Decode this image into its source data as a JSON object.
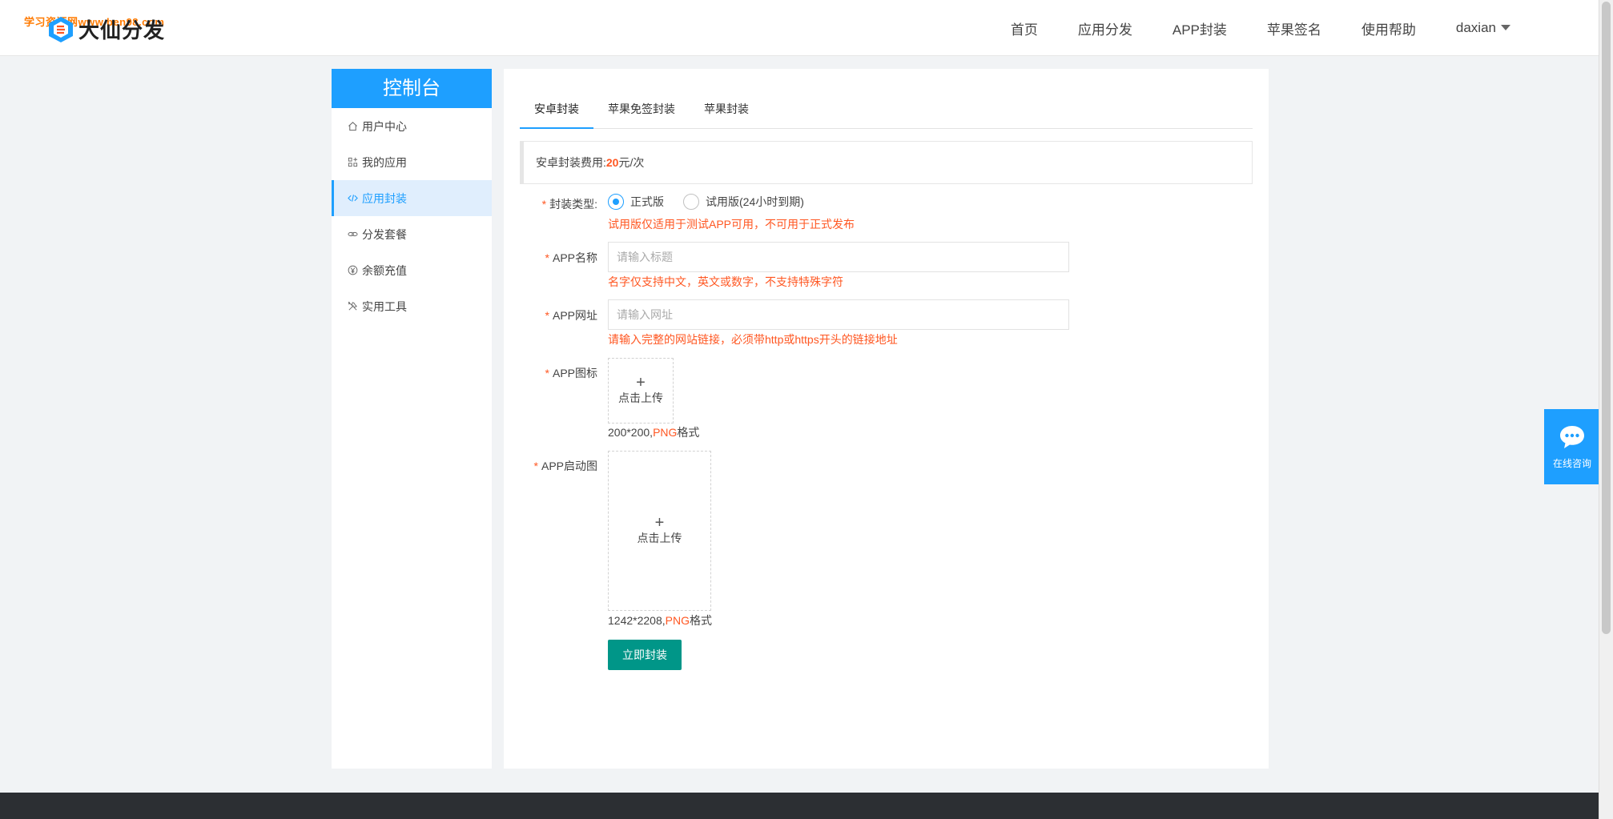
{
  "header": {
    "watermark": "学习资源网www.ben98.com",
    "logo_text": "大仙分发",
    "nav": [
      {
        "label": "首页"
      },
      {
        "label": "应用分发"
      },
      {
        "label": "APP封装"
      },
      {
        "label": "苹果签名"
      },
      {
        "label": "使用帮助"
      }
    ],
    "user": "daxian"
  },
  "sidebar": {
    "title": "控制台",
    "items": [
      {
        "label": "用户中心",
        "icon": "home-icon"
      },
      {
        "label": "我的应用",
        "icon": "apps-icon"
      },
      {
        "label": "应用封装",
        "icon": "code-icon",
        "active": true
      },
      {
        "label": "分发套餐",
        "icon": "link-icon"
      },
      {
        "label": "余额充值",
        "icon": "yen-icon"
      },
      {
        "label": "实用工具",
        "icon": "tools-icon"
      }
    ]
  },
  "tabs": [
    {
      "label": "安卓封装",
      "active": true
    },
    {
      "label": "苹果免签封装"
    },
    {
      "label": "苹果封装"
    }
  ],
  "notice": {
    "prefix": "安卓封装费用:",
    "amount": "20",
    "suffix": "元/次"
  },
  "form": {
    "type": {
      "label": "封装类型:",
      "options": [
        {
          "label": "正式版",
          "checked": true
        },
        {
          "label": "试用版(24小时到期)",
          "checked": false
        }
      ],
      "hint": "试用版仅适用于测试APP可用，不可用于正式发布"
    },
    "name": {
      "label": "APP名称",
      "placeholder": "请输入标题",
      "value": "",
      "hint": "名字仅支持中文，英文或数字，不支持特殊字符"
    },
    "url": {
      "label": "APP网址",
      "placeholder": "请输入网址",
      "value": "",
      "hint": "请输入完整的网站链接，必须带http或https开头的链接地址"
    },
    "icon": {
      "label": "APP图标",
      "upload_label": "点击上传",
      "format_size": "200*200,",
      "format_type": "PNG",
      "format_suffix": "格式"
    },
    "splash": {
      "label": "APP启动图",
      "upload_label": "点击上传",
      "format_size": "1242*2208,",
      "format_type": "PNG",
      "format_suffix": "格式"
    },
    "submit_label": "立即封装"
  },
  "consult": {
    "label": "在线咨询"
  },
  "colors": {
    "primary": "#1e9fff",
    "accent": "#ff5722",
    "submit": "#009688",
    "footer": "#2c2f33"
  }
}
